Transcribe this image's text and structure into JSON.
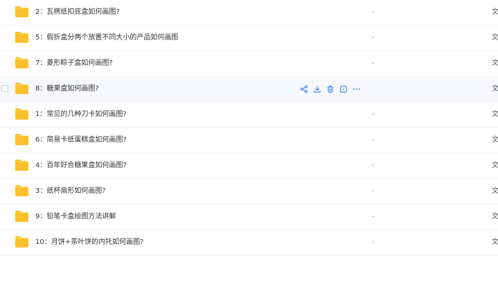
{
  "colors": {
    "accent": "#3b82f6",
    "folder": "#fbc02d",
    "row_hover": "#f6f8fc"
  },
  "files": [
    {
      "name": "2：瓦楞纸扣底盒如何画图?",
      "size": "-",
      "type": "文"
    },
    {
      "name": "5：假折盒分两个放置不同大小的产品如何画图",
      "size": "-",
      "type": "文"
    },
    {
      "name": "7：菱形粽子盒如何画图?",
      "size": "-",
      "type": "文"
    },
    {
      "name": "8：糖果盒如何画图?",
      "size": "-",
      "type": "文"
    },
    {
      "name": "1：常见的几种刀卡如何画图?",
      "size": "-",
      "type": "文"
    },
    {
      "name": "6：简易卡纸蛋糕盒如何画图?",
      "size": "-",
      "type": "文"
    },
    {
      "name": "4：百年好合糖果盒如何画图?",
      "size": "-",
      "type": "文"
    },
    {
      "name": "3：纸杯扇形如何画图?",
      "size": "-",
      "type": "文"
    },
    {
      "name": "9：铅笔卡盒绘图方法讲解",
      "size": "-",
      "type": "文"
    },
    {
      "name": "10：月饼+茶叶饼的内托如何画图?",
      "size": "-",
      "type": "文"
    }
  ],
  "row_actions": {
    "icons": [
      "share-icon",
      "download-icon",
      "delete-icon",
      "info-icon",
      "more-icon"
    ],
    "more_label": "···"
  }
}
